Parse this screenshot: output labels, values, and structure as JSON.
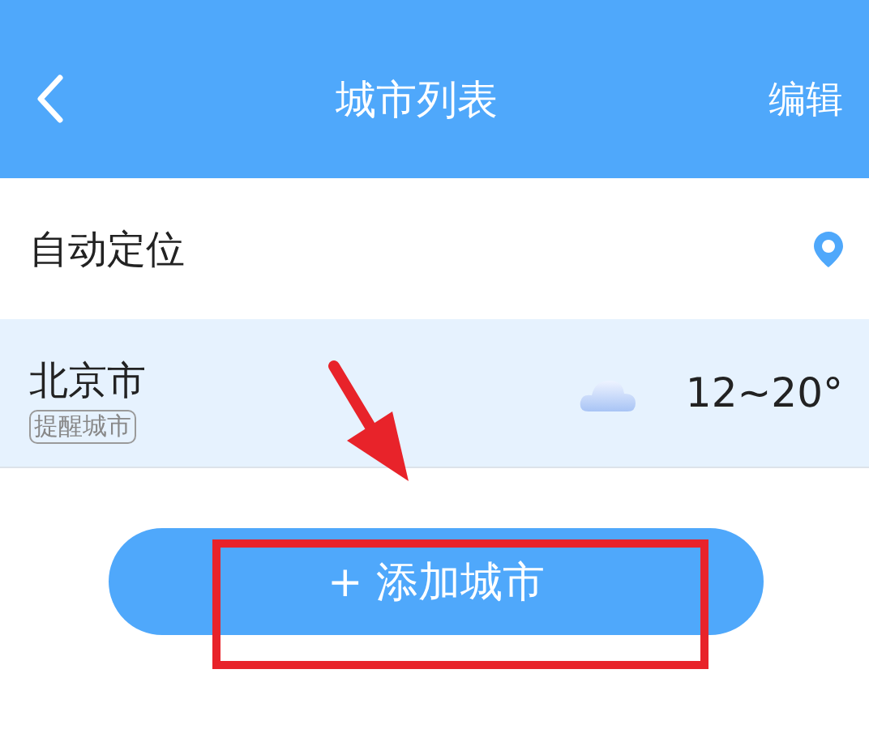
{
  "header": {
    "title": "城市列表",
    "action": "编辑"
  },
  "auto_location": {
    "label": "自动定位"
  },
  "cities": [
    {
      "name": "北京市",
      "tag": "提醒城市",
      "temperature": "12~20°"
    }
  ],
  "add_button": {
    "label": "+ 添加城市"
  },
  "annotation": {
    "arrow": true,
    "highlight_box": true
  }
}
